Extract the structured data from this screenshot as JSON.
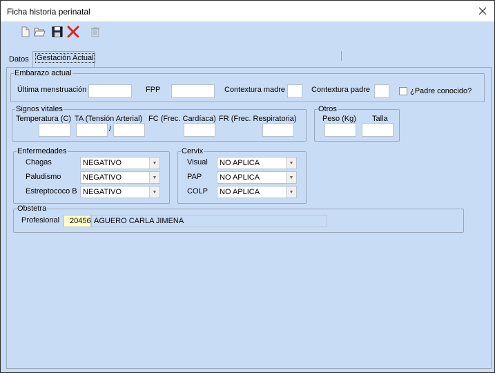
{
  "window": {
    "title": "Ficha historia perinatal"
  },
  "toolbar": {
    "icons": [
      "new-document-icon",
      "open-folder-icon",
      "save-icon",
      "delete-icon",
      "trash-icon"
    ],
    "accent_red": "#e02020"
  },
  "tabs": [
    {
      "label": "Datos",
      "active": false
    },
    {
      "label": "Gestación Actual",
      "active": true
    }
  ],
  "embarazo": {
    "legend": "Embarazo actual",
    "ultima_label": "Última menstruación",
    "ultima_value": "",
    "fpp_label": "FPP",
    "fpp_value": "",
    "contextura_madre_label": "Contextura madre",
    "contextura_madre_value": "",
    "contextura_padre_label": "Contextura padre",
    "contextura_padre_value": "",
    "padre_conocido_label": "¿Padre conocido?",
    "padre_conocido_checked": false
  },
  "signos": {
    "legend": "Signos vitales",
    "temp_label": "Temperatura (C)",
    "ta_label": "TA (Tensión Arterial)",
    "ta_separator": "/",
    "fc_label": "FC (Frec. Cardíaca)",
    "fr_label": "FR  (Frec. Respiratoria)"
  },
  "otros": {
    "legend": "Otros",
    "peso_label": "Peso (Kg)",
    "talla_label": "Talla"
  },
  "enfermedades": {
    "legend": "Enfermedades",
    "rows": [
      {
        "label": "Chagas",
        "value": "NEGATIVO"
      },
      {
        "label": "Paludismo",
        "value": "NEGATIVO"
      },
      {
        "label": "Estreptococo B",
        "value": "NEGATIVO"
      }
    ]
  },
  "cervix": {
    "legend": "Cervix",
    "rows": [
      {
        "label": "Visual",
        "value": "NO APLICA"
      },
      {
        "label": "PAP",
        "value": "NO APLICA"
      },
      {
        "label": "COLP",
        "value": "NO APLICA"
      }
    ]
  },
  "obstetra": {
    "legend": "Obstetra",
    "profesional_label": "Profesional",
    "codigo": "20456",
    "nombre": "AGUERO CARLA JIMENA"
  }
}
